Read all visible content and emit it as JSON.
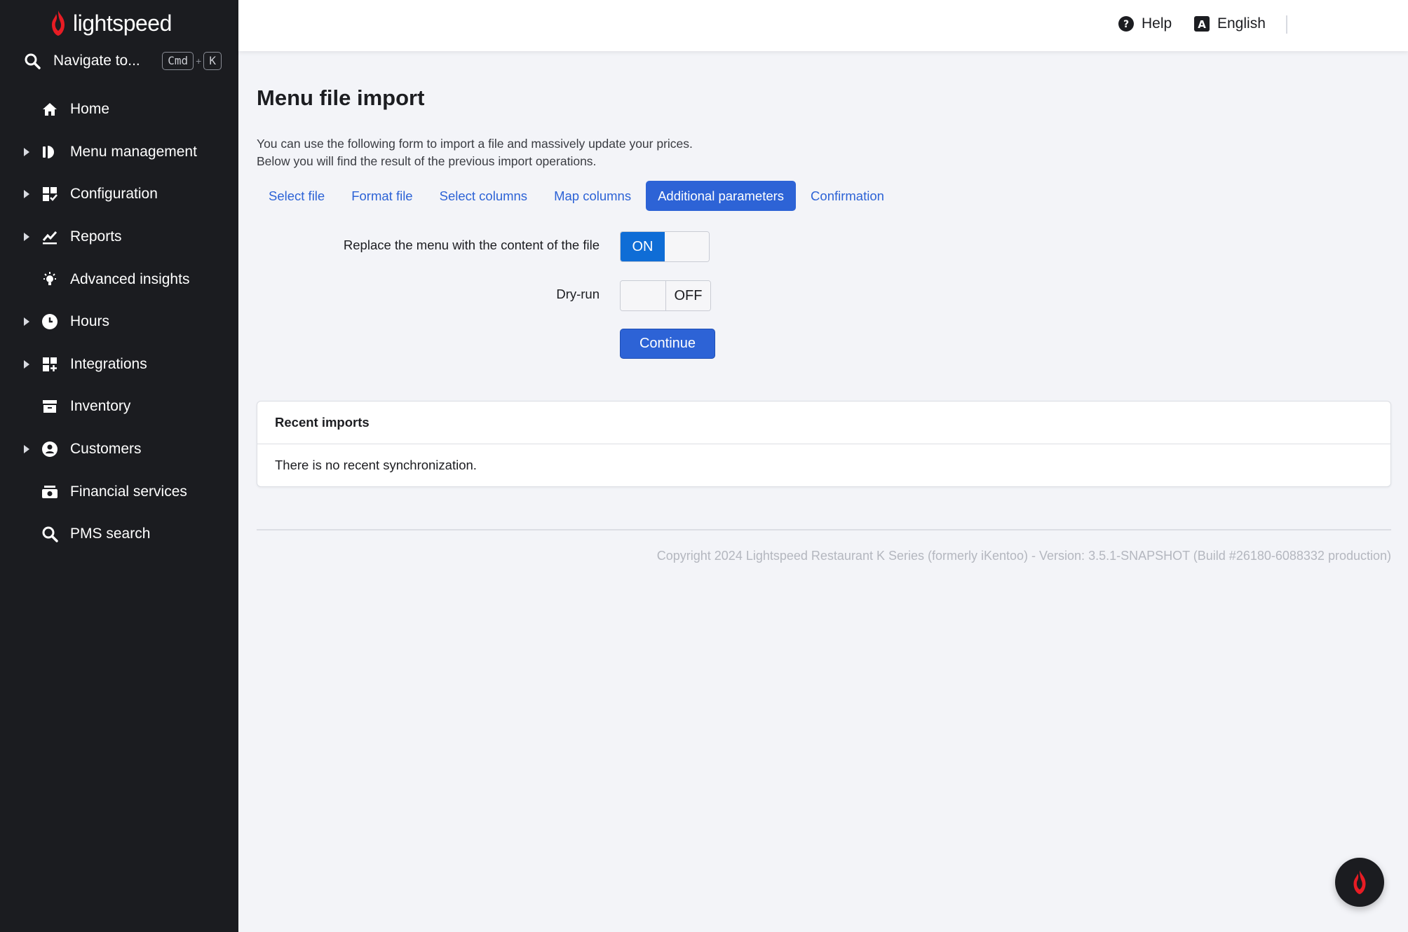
{
  "app": {
    "brand": "lightspeed",
    "brand_color": "#e81c24",
    "accent": "#2d63d6"
  },
  "sidebar": {
    "search": {
      "label": "Navigate to...",
      "key1": "Cmd",
      "plus": "+",
      "key2": "K"
    },
    "items": [
      {
        "label": "Home",
        "icon": "home-icon",
        "expandable": false
      },
      {
        "label": "Menu management",
        "icon": "menu-management-icon",
        "expandable": true
      },
      {
        "label": "Configuration",
        "icon": "configuration-icon",
        "expandable": true
      },
      {
        "label": "Reports",
        "icon": "reports-chart-icon",
        "expandable": true
      },
      {
        "label": "Advanced insights",
        "icon": "lightbulb-icon",
        "expandable": false
      },
      {
        "label": "Hours",
        "icon": "clock-icon",
        "expandable": true
      },
      {
        "label": "Integrations",
        "icon": "integrations-icon",
        "expandable": true
      },
      {
        "label": "Inventory",
        "icon": "inventory-icon",
        "expandable": false
      },
      {
        "label": "Customers",
        "icon": "customers-icon",
        "expandable": true
      },
      {
        "label": "Financial services",
        "icon": "financial-services-icon",
        "expandable": false
      },
      {
        "label": "PMS search",
        "icon": "search-icon",
        "expandable": false
      }
    ]
  },
  "topbar": {
    "help": "Help",
    "language": "English"
  },
  "page": {
    "title": "Menu file import",
    "description_line1": "You can use the following form to import a file and massively update your prices.",
    "description_line2": "Below you will find the result of the previous import operations."
  },
  "steps": [
    {
      "label": "Select file",
      "active": false
    },
    {
      "label": "Format file",
      "active": false
    },
    {
      "label": "Select columns",
      "active": false
    },
    {
      "label": "Map columns",
      "active": false
    },
    {
      "label": "Additional parameters",
      "active": true
    },
    {
      "label": "Confirmation",
      "active": false
    }
  ],
  "form": {
    "replace_label": "Replace the menu with the content of the file",
    "replace_state": "ON",
    "dryrun_label": "Dry-run",
    "dryrun_state": "OFF",
    "continue_label": "Continue"
  },
  "recent_imports": {
    "title": "Recent imports",
    "empty_text": "There is no recent synchronization."
  },
  "footer": {
    "copyright": "Copyright 2024 Lightspeed Restaurant K Series (formerly iKentoo) - Version: 3.5.1-SNAPSHOT (Build #26180-6088332 production)"
  }
}
